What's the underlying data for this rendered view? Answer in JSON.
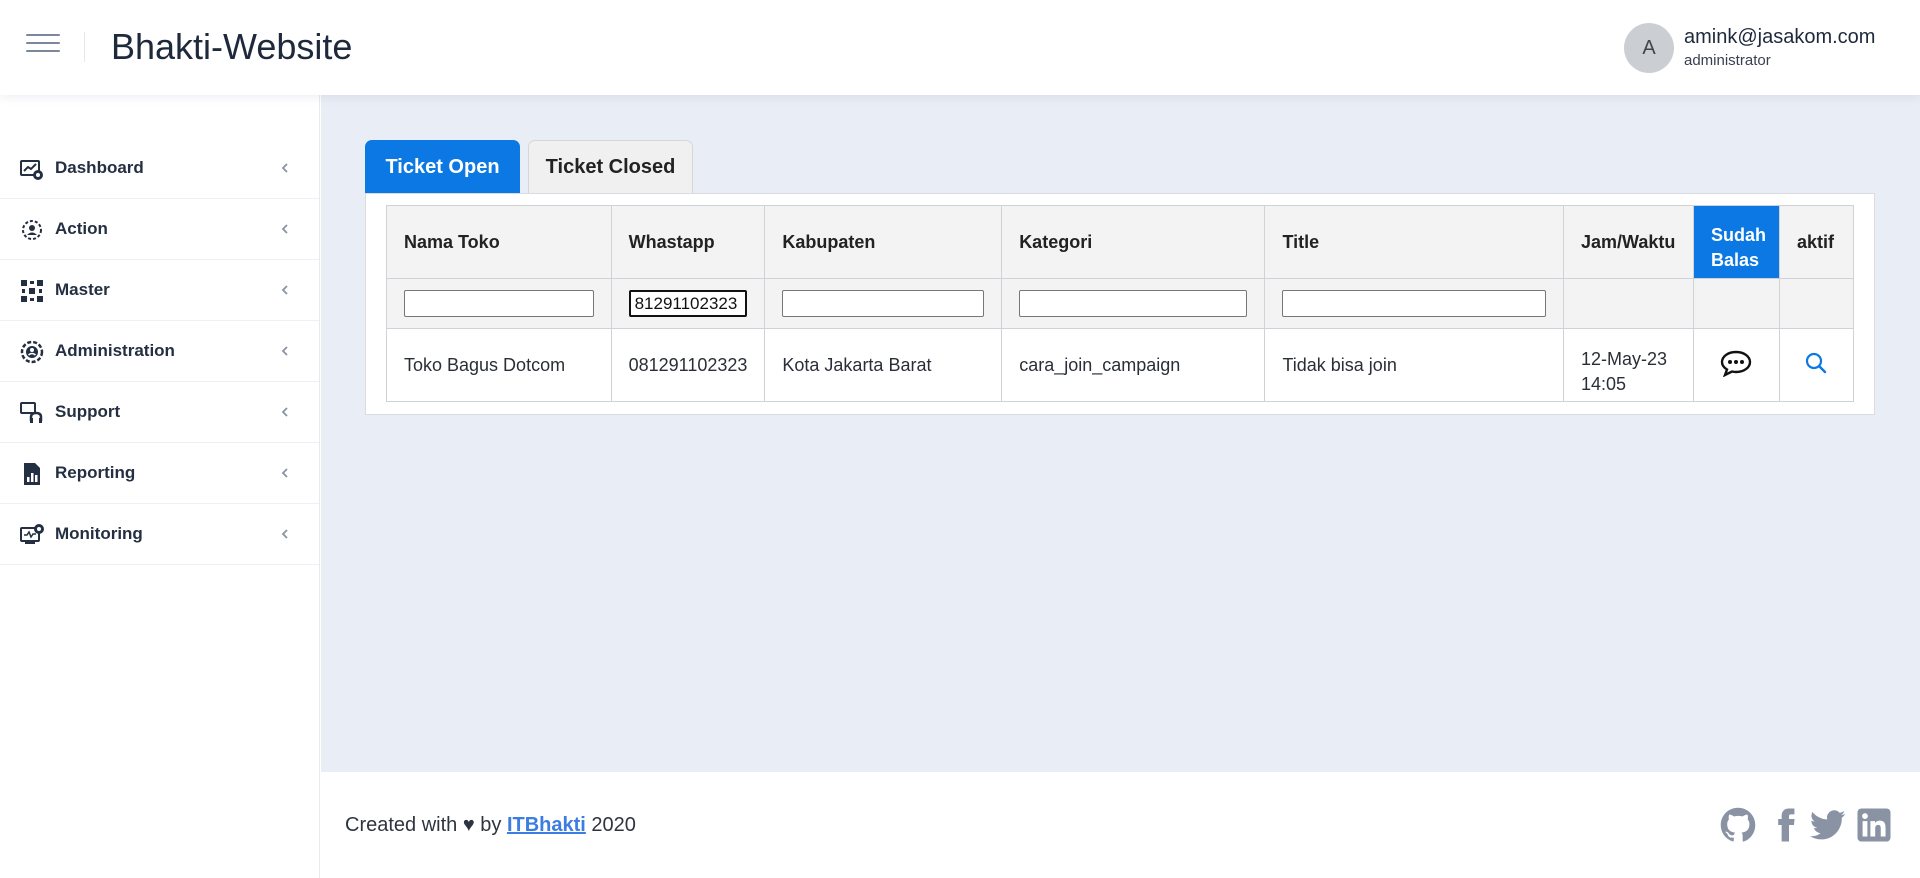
{
  "header": {
    "app_title": "Bhakti-Website",
    "avatar_initial": "A",
    "user_email": "amink@jasakom.com",
    "user_role": "administrator"
  },
  "sidebar": {
    "items": [
      {
        "label": "Dashboard",
        "icon": "dashboard-icon"
      },
      {
        "label": "Action",
        "icon": "action-icon"
      },
      {
        "label": "Master",
        "icon": "master-icon"
      },
      {
        "label": "Administration",
        "icon": "administration-icon"
      },
      {
        "label": "Support",
        "icon": "support-icon"
      },
      {
        "label": "Reporting",
        "icon": "reporting-icon"
      },
      {
        "label": "Monitoring",
        "icon": "monitoring-icon"
      }
    ]
  },
  "tabs": {
    "open": "Ticket Open",
    "closed": "Ticket Closed",
    "active": "open"
  },
  "table": {
    "columns": [
      "Nama Toko",
      "Whastapp",
      "Kabupaten",
      "Kategori",
      "Title",
      "Jam/Waktu",
      "Sudah Balas",
      "aktif"
    ],
    "filters": {
      "nama_toko": "",
      "whatsapp": "81291102323",
      "kabupaten": "",
      "kategori": "",
      "title": ""
    },
    "rows": [
      {
        "nama_toko": "Toko Bagus Dotcom",
        "whatsapp": "081291102323",
        "kabupaten": "Kota Jakarta Barat",
        "kategori": "cara_join_campaign",
        "title": "Tidak bisa join",
        "jam_waktu_date": "12-May-23",
        "jam_waktu_time": "14:05",
        "reply_icon": "chat-bubble-icon",
        "view_icon": "search-icon"
      }
    ]
  },
  "footer": {
    "prefix": "Created with ♥ by ",
    "link": "ITBhakti",
    "suffix": " 2020",
    "social": [
      "github-icon",
      "facebook-icon",
      "twitter-icon",
      "linkedin-icon"
    ]
  },
  "colors": {
    "accent": "#0b78e3",
    "main_bg": "#e9edf5",
    "icon_gray": "#8a93a3"
  }
}
